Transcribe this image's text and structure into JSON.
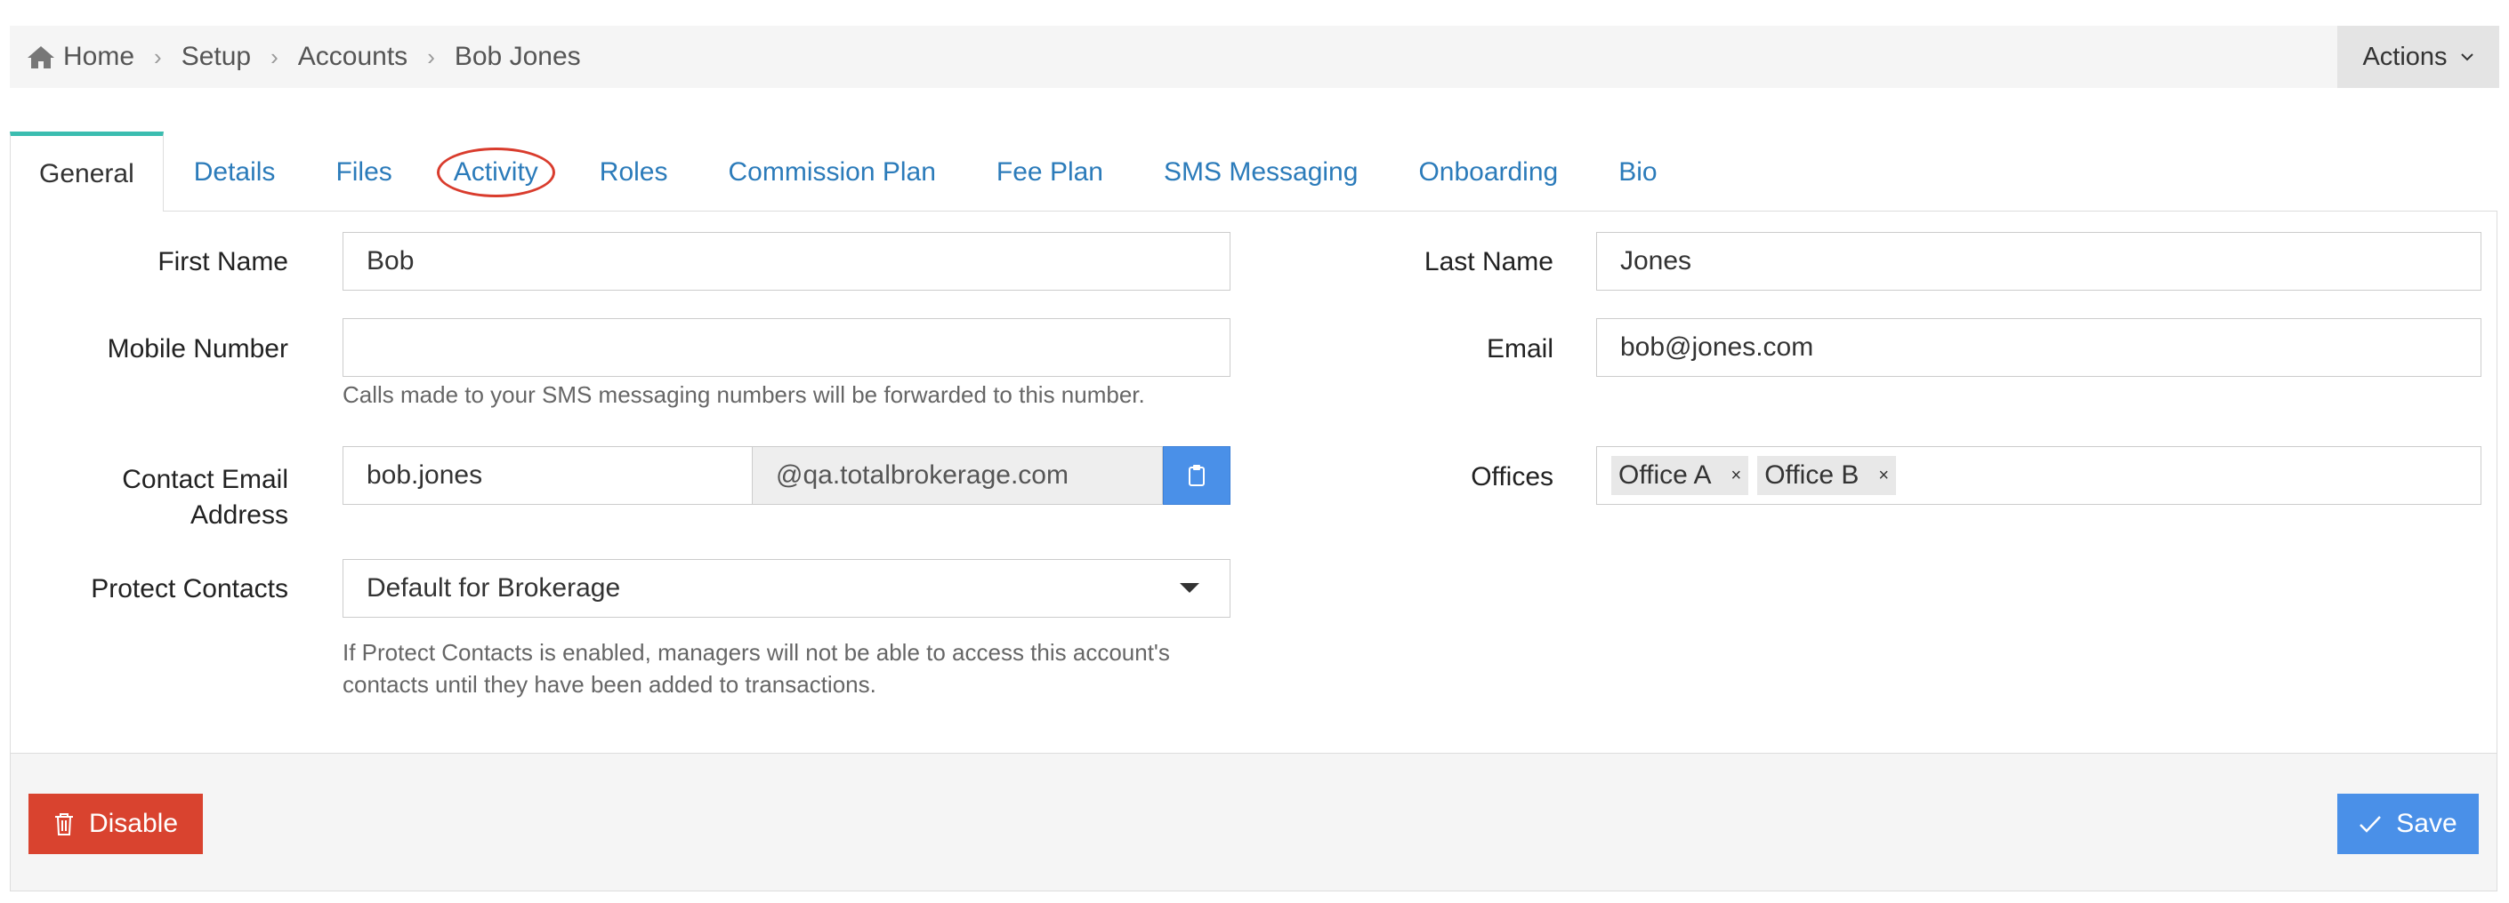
{
  "breadcrumb": {
    "home": "Home",
    "items": [
      "Setup",
      "Accounts",
      "Bob Jones"
    ]
  },
  "actions_label": "Actions",
  "tabs": [
    {
      "label": "General",
      "active": true
    },
    {
      "label": "Details"
    },
    {
      "label": "Files"
    },
    {
      "label": "Activity",
      "highlighted": true
    },
    {
      "label": "Roles"
    },
    {
      "label": "Commission Plan"
    },
    {
      "label": "Fee Plan"
    },
    {
      "label": "SMS Messaging"
    },
    {
      "label": "Onboarding"
    },
    {
      "label": "Bio"
    }
  ],
  "form": {
    "first_name": {
      "label": "First Name",
      "value": "Bob"
    },
    "last_name": {
      "label": "Last Name",
      "value": "Jones"
    },
    "mobile": {
      "label": "Mobile Number",
      "value": "",
      "help": "Calls made to your SMS messaging numbers will be forwarded to this number."
    },
    "email": {
      "label": "Email",
      "value": "bob@jones.com"
    },
    "contact_email": {
      "label_line1": "Contact Email",
      "label_line2": "Address",
      "value": "bob.jones",
      "domain": "@qa.totalbrokerage.com"
    },
    "offices": {
      "label": "Offices",
      "tags": [
        "Office A",
        "Office B"
      ],
      "remove_glyph": "×"
    },
    "protect_contacts": {
      "label": "Protect Contacts",
      "value": "Default for Brokerage",
      "help_line1": "If Protect Contacts is enabled, managers will not be able to access this account's",
      "help_line2": "contacts until they have been added to transactions."
    }
  },
  "buttons": {
    "disable": "Disable",
    "save": "Save"
  },
  "colors": {
    "link": "#2b7bba",
    "tab_accent": "#3bbdb0",
    "danger": "#d9432f",
    "primary": "#4a90e8",
    "highlight_circle": "#d93c2d"
  }
}
